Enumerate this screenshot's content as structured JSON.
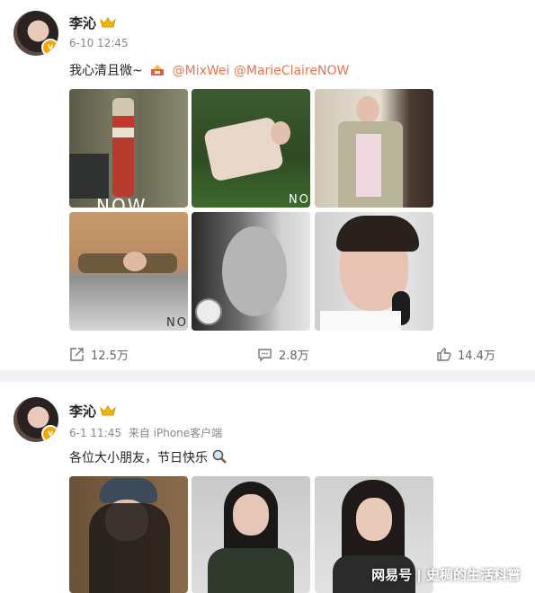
{
  "posts": [
    {
      "author": "李沁",
      "time": "6-10 12:45",
      "text": "我心清且微~",
      "mentions": [
        "@MixWei",
        "@MarieClaireNOW"
      ],
      "stats": {
        "share": "12.5万",
        "comment": "2.8万",
        "like": "14.4万"
      },
      "photo_tags": [
        "NOW",
        "NO",
        "NO"
      ]
    },
    {
      "author": "李沁",
      "time": "6-1 11:45",
      "source": "来自 iPhone客户端",
      "text": "各位大小朋友，节日快乐"
    }
  ],
  "watermark": "网易号 | 史稠的生活科普",
  "colors": {
    "mention": "#eb7350",
    "badge": "#f7a400"
  },
  "icons": [
    "crown-badge-icon",
    "verified-v-icon",
    "share-icon",
    "comment-icon",
    "like-icon",
    "magnifier-emoji-icon"
  ]
}
